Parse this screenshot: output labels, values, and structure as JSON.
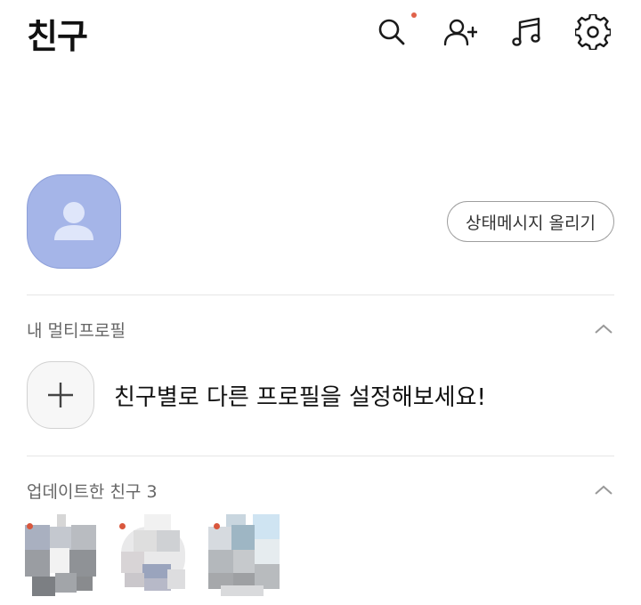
{
  "header": {
    "title": "친구",
    "icons": [
      "search-icon",
      "add-friend-icon",
      "music-icon",
      "settings-icon"
    ],
    "search_has_notification": true
  },
  "my_profile": {
    "avatar_icon": "person-icon",
    "avatar_color": "#a5b5e8",
    "status_button_label": "상태메시지 올리기"
  },
  "multi_profile": {
    "section_title": "내 멀티프로필",
    "cta_text": "친구별로 다른 프로필을 설정해보세요!",
    "add_icon": "plus-icon"
  },
  "updated_friends": {
    "section_title": "업데이트한 친구 3",
    "friends": [
      {
        "avatar": "blurred-avatar",
        "has_new": true
      },
      {
        "avatar": "blurred-avatar",
        "has_new": true
      },
      {
        "avatar": "blurred-avatar",
        "has_new": true
      }
    ]
  },
  "colors": {
    "accent_dot": "#e0624a",
    "divider": "#e6e6e6"
  }
}
